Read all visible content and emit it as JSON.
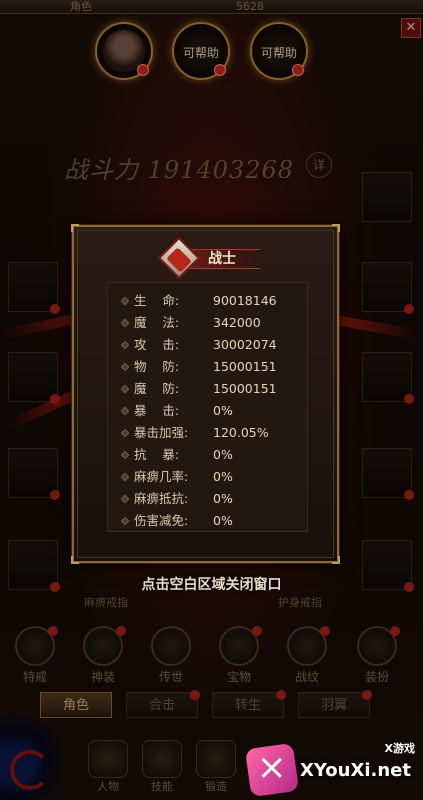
{
  "header": {
    "tab_label": "角色",
    "currency_value": "5628",
    "close_icon": "close-icon"
  },
  "portraits": [
    {
      "label": ""
    },
    {
      "label": "可帮助"
    },
    {
      "label": "可帮助"
    }
  ],
  "power": {
    "label": "战斗力",
    "value": "191403268",
    "detail_label": "详"
  },
  "slot_captions": {
    "left": "麻痹戒指",
    "right": "护身戒指"
  },
  "popup": {
    "class_name": "战士",
    "stats": [
      {
        "label": "生    命:",
        "value": "90018146"
      },
      {
        "label": "魔    法:",
        "value": "342000"
      },
      {
        "label": "攻    击:",
        "value": "30002074"
      },
      {
        "label": "物    防:",
        "value": "15000151"
      },
      {
        "label": "魔    防:",
        "value": "15000151"
      },
      {
        "label": "暴    击:",
        "value": "0%"
      },
      {
        "label": "暴击加强:",
        "value": "120.05%"
      },
      {
        "label": "抗    暴:",
        "value": "0%"
      },
      {
        "label": "麻痹几率:",
        "value": "0%"
      },
      {
        "label": "麻痹抵抗:",
        "value": "0%"
      },
      {
        "label": "伤害减免:",
        "value": "0%"
      }
    ],
    "close_hint": "点击空白区域关闭窗口"
  },
  "features": [
    {
      "label": "特戒"
    },
    {
      "label": "神装"
    },
    {
      "label": "传世"
    },
    {
      "label": "宝物"
    },
    {
      "label": "战纹"
    },
    {
      "label": "装扮"
    }
  ],
  "subtabs": [
    {
      "label": "角色",
      "active": true
    },
    {
      "label": "合击",
      "active": false
    },
    {
      "label": "转生",
      "active": false
    },
    {
      "label": "羽翼",
      "active": false
    }
  ],
  "bottom_nav": [
    {
      "label": "人物"
    },
    {
      "label": "技能"
    },
    {
      "label": "锻造"
    }
  ],
  "watermark": {
    "tag": "X游戏",
    "site": "XYouXi.net"
  },
  "colors": {
    "frame_gold": "#8a6a40",
    "stat_text": "#d8c9a8",
    "badge_red": "#b3271d"
  }
}
